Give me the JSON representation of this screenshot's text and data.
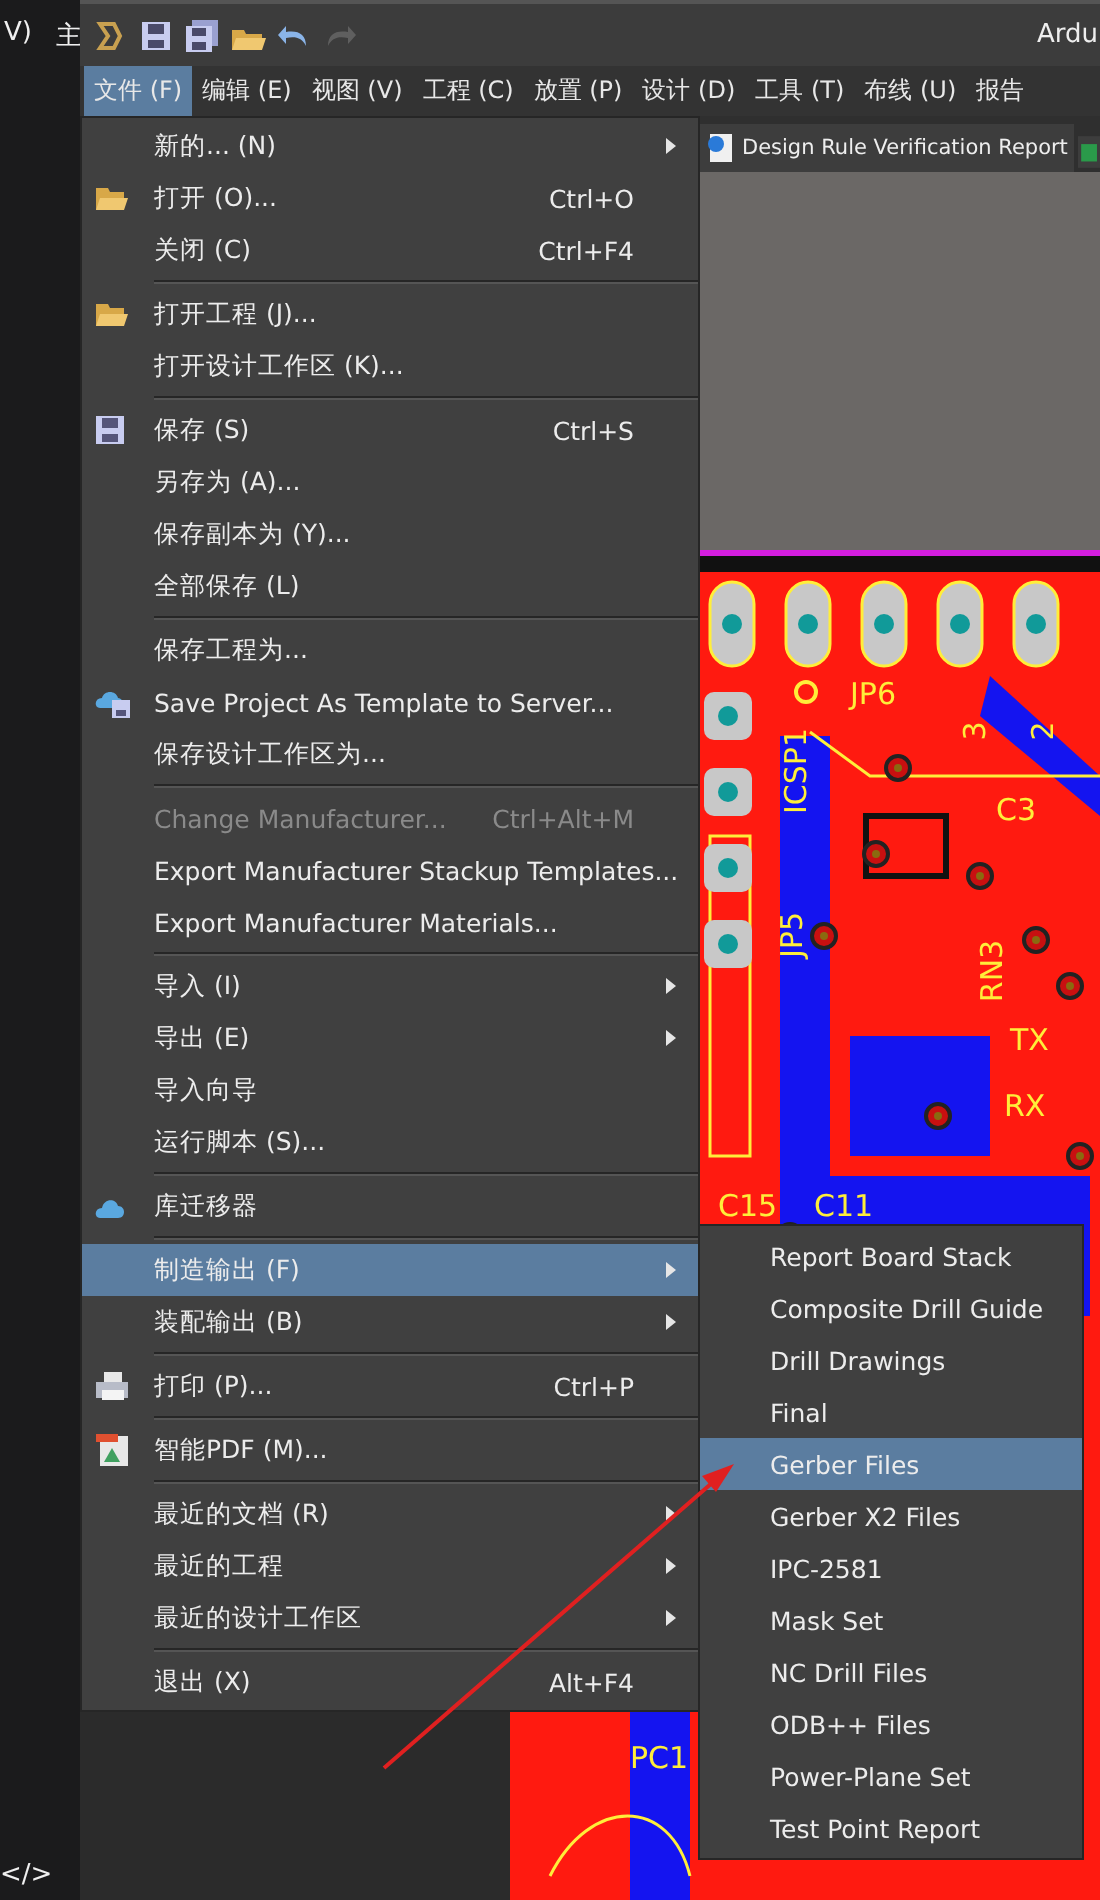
{
  "background_texts": [
    {
      "text": "V)"
    },
    {
      "text": "主"
    },
    {
      "text": "</>"
    }
  ],
  "title_bar": {
    "toolbar_buttons": [
      {
        "kind": "logo",
        "disabled": false
      },
      {
        "kind": "save",
        "disabled": false
      },
      {
        "kind": "save_all",
        "disabled": false
      },
      {
        "kind": "open",
        "disabled": false
      },
      {
        "kind": "undo",
        "disabled": false
      },
      {
        "kind": "redo",
        "disabled": true
      }
    ],
    "title": "Ardu"
  },
  "menu_bar": [
    {
      "label": "文件 (F)",
      "selected": true
    },
    {
      "label": "编辑 (E)",
      "selected": false
    },
    {
      "label": "视图 (V)",
      "selected": false
    },
    {
      "label": "工程 (C)",
      "selected": false
    },
    {
      "label": "放置 (P)",
      "selected": false
    },
    {
      "label": "设计 (D)",
      "selected": false
    },
    {
      "label": "工具 (T)",
      "selected": false
    },
    {
      "label": "布线 (U)",
      "selected": false
    },
    {
      "label": "报告",
      "selected": false
    }
  ],
  "document_tab": {
    "label": "Design Rule Verification Report"
  },
  "pcb_labels": [
    {
      "text": "JP6",
      "kind": "flat"
    },
    {
      "text": "3",
      "kind": "rotated"
    },
    {
      "text": "2",
      "kind": "rotated"
    },
    {
      "text": "C3",
      "kind": "flat"
    },
    {
      "text": "ICSP1",
      "kind": "rotated"
    },
    {
      "text": "JP5",
      "kind": "rotated"
    },
    {
      "text": "RN3",
      "kind": "rotated"
    },
    {
      "text": "TX",
      "kind": "flat"
    },
    {
      "text": "RX",
      "kind": "flat"
    },
    {
      "text": "C15",
      "kind": "flat"
    },
    {
      "text": "C11",
      "kind": "flat"
    },
    {
      "text": "PC1",
      "kind": "flat"
    }
  ],
  "file_menu": [
    {
      "kind": "item",
      "label": "新的... (N)",
      "submenu": true,
      "disabled": false,
      "selected": false
    },
    {
      "kind": "item",
      "label": "打开 (O)...",
      "shortcut": "Ctrl+O",
      "submenu": false,
      "disabled": false,
      "selected": false
    },
    {
      "kind": "item",
      "label": "关闭 (C)",
      "shortcut": "Ctrl+F4",
      "submenu": false,
      "disabled": false,
      "selected": false
    },
    {
      "kind": "separator"
    },
    {
      "kind": "item",
      "label": "打开工程 (J)...",
      "submenu": false,
      "disabled": false,
      "selected": false
    },
    {
      "kind": "item",
      "label": "打开设计工作区 (K)...",
      "submenu": false,
      "disabled": false,
      "selected": false
    },
    {
      "kind": "separator"
    },
    {
      "kind": "item",
      "label": "保存 (S)",
      "shortcut": "Ctrl+S",
      "submenu": false,
      "disabled": false,
      "selected": false
    },
    {
      "kind": "item",
      "label": "另存为 (A)...",
      "submenu": false,
      "disabled": false,
      "selected": false
    },
    {
      "kind": "item",
      "label": "保存副本为 (Y)...",
      "submenu": false,
      "disabled": false,
      "selected": false
    },
    {
      "kind": "item",
      "label": "全部保存 (L)",
      "submenu": false,
      "disabled": false,
      "selected": false
    },
    {
      "kind": "separator"
    },
    {
      "kind": "item",
      "label": "保存工程为...",
      "submenu": false,
      "disabled": false,
      "selected": false
    },
    {
      "kind": "item",
      "label": "Save Project As Template to Server...",
      "submenu": false,
      "disabled": false,
      "selected": false
    },
    {
      "kind": "item",
      "label": "保存设计工作区为...",
      "submenu": false,
      "disabled": false,
      "selected": false
    },
    {
      "kind": "separator"
    },
    {
      "kind": "item",
      "label": "Change Manufacturer...",
      "shortcut": "Ctrl+Alt+M",
      "submenu": false,
      "disabled": true,
      "selected": false
    },
    {
      "kind": "item",
      "label": "Export Manufacturer Stackup Templates...",
      "submenu": false,
      "disabled": false,
      "selected": false
    },
    {
      "kind": "item",
      "label": "Export Manufacturer Materials...",
      "submenu": false,
      "disabled": false,
      "selected": false
    },
    {
      "kind": "separator"
    },
    {
      "kind": "item",
      "label": "导入 (I)",
      "submenu": true,
      "disabled": false,
      "selected": false
    },
    {
      "kind": "item",
      "label": "导出 (E)",
      "submenu": true,
      "disabled": false,
      "selected": false
    },
    {
      "kind": "item",
      "label": "导入向导",
      "submenu": false,
      "disabled": false,
      "selected": false
    },
    {
      "kind": "item",
      "label": "运行脚本 (S)...",
      "submenu": false,
      "disabled": false,
      "selected": false
    },
    {
      "kind": "separator"
    },
    {
      "kind": "item",
      "label": "库迁移器",
      "submenu": false,
      "disabled": false,
      "selected": false
    },
    {
      "kind": "separator"
    },
    {
      "kind": "item",
      "label": "制造输出 (F)",
      "submenu": true,
      "disabled": false,
      "selected": true
    },
    {
      "kind": "item",
      "label": "装配输出 (B)",
      "submenu": true,
      "disabled": false,
      "selected": false
    },
    {
      "kind": "separator"
    },
    {
      "kind": "item",
      "label": "打印 (P)...",
      "shortcut": "Ctrl+P",
      "submenu": false,
      "disabled": false,
      "selected": false
    },
    {
      "kind": "separator"
    },
    {
      "kind": "item",
      "label": "智能PDF (M)...",
      "submenu": false,
      "disabled": false,
      "selected": false
    },
    {
      "kind": "separator"
    },
    {
      "kind": "item",
      "label": "最近的文档 (R)",
      "submenu": true,
      "disabled": false,
      "selected": false
    },
    {
      "kind": "item",
      "label": "最近的工程",
      "submenu": true,
      "disabled": false,
      "selected": false
    },
    {
      "kind": "item",
      "label": "最近的设计工作区",
      "submenu": true,
      "disabled": false,
      "selected": false
    },
    {
      "kind": "separator"
    },
    {
      "kind": "item",
      "label": "退出 (X)",
      "shortcut": "Alt+F4",
      "submenu": false,
      "disabled": false,
      "selected": false
    }
  ],
  "fabrication_submenu": [
    {
      "label": "Report Board Stack",
      "selected": false
    },
    {
      "label": "Composite Drill Guide",
      "selected": false
    },
    {
      "label": "Drill Drawings",
      "selected": false
    },
    {
      "label": "Final",
      "selected": false
    },
    {
      "label": "Gerber Files",
      "selected": true
    },
    {
      "label": "Gerber X2 Files",
      "selected": false
    },
    {
      "label": "IPC-2581",
      "selected": false
    },
    {
      "label": "Mask Set",
      "selected": false
    },
    {
      "label": "NC Drill Files",
      "selected": false
    },
    {
      "label": "ODB++ Files",
      "selected": false
    },
    {
      "label": "Power-Plane Set",
      "selected": false
    },
    {
      "label": "Test Point Report",
      "selected": false
    }
  ]
}
